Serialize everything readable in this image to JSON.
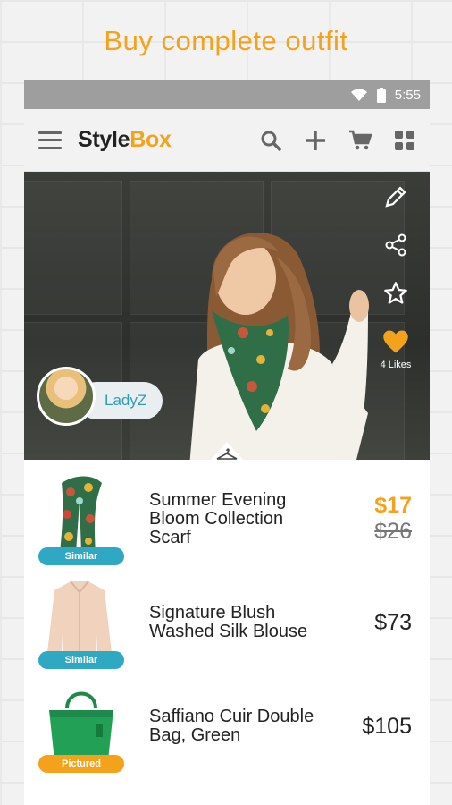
{
  "promo": {
    "title": "Buy complete outfit"
  },
  "status_bar": {
    "time": "5:55"
  },
  "app_bar": {
    "brand_part1": "Style",
    "brand_part2": "Box"
  },
  "hero": {
    "likes_count": "4",
    "likes_label": "Likes",
    "user": {
      "name": "LadyZ"
    }
  },
  "products": [
    {
      "name": "Summer Evening Bloom Collection Scarf",
      "tag": "Similar",
      "price": "$17",
      "original_price": "$26"
    },
    {
      "name": "Signature Blush Washed Silk Blouse",
      "tag": "Similar",
      "price": "$73"
    },
    {
      "name": "Saffiano Cuir Double  Bag, Green",
      "tag": "Pictured",
      "price": "$105"
    }
  ],
  "colors": {
    "accent": "#f4a21c",
    "similar_tag": "#2fa8c4",
    "username": "#2f9db5"
  },
  "icons": [
    "wifi-icon",
    "battery-icon",
    "menu-icon",
    "search-icon",
    "plus-icon",
    "cart-icon",
    "grid-icon",
    "pencil-icon",
    "share-icon",
    "star-icon",
    "heart-icon",
    "hanger-icon"
  ]
}
